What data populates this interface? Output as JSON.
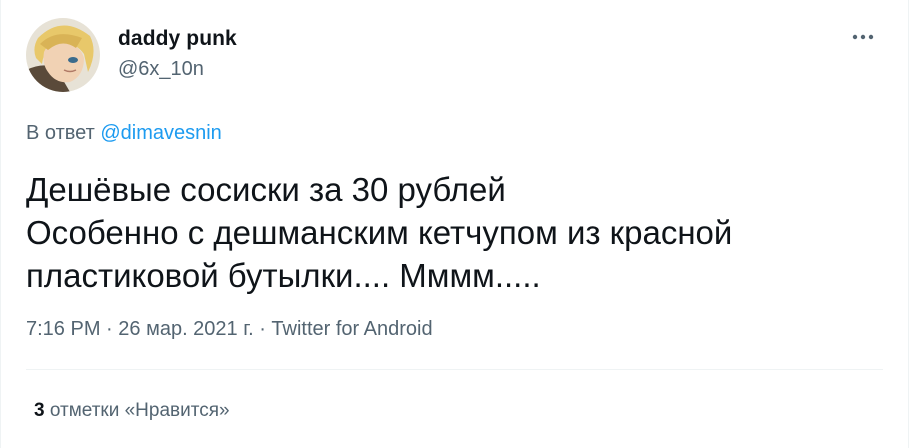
{
  "author": {
    "display_name": "daddy punk",
    "handle": "@6x_10n",
    "avatar_icon": "anime-character-avatar"
  },
  "reply": {
    "prefix": "В ответ",
    "mention": "@dimavesnin"
  },
  "tweet": {
    "lines": [
      "Дешёвые сосиски за 30 рублей",
      "Особенно с дешманским кетчупом из красной",
      "пластиковой бутылки.... Мммм....."
    ]
  },
  "meta": {
    "time": "7:16 PM",
    "separator": " · ",
    "date": "26 мар. 2021 г.",
    "source": "Twitter for Android"
  },
  "stats": {
    "likes_count": "3",
    "likes_label": "отметки «Нравится»"
  },
  "colors": {
    "text": "#0f1419",
    "secondary": "#536471",
    "accent": "#1d9bf0",
    "divider": "#eff3f4"
  },
  "icons": {
    "more": "more-horizontal-icon"
  }
}
